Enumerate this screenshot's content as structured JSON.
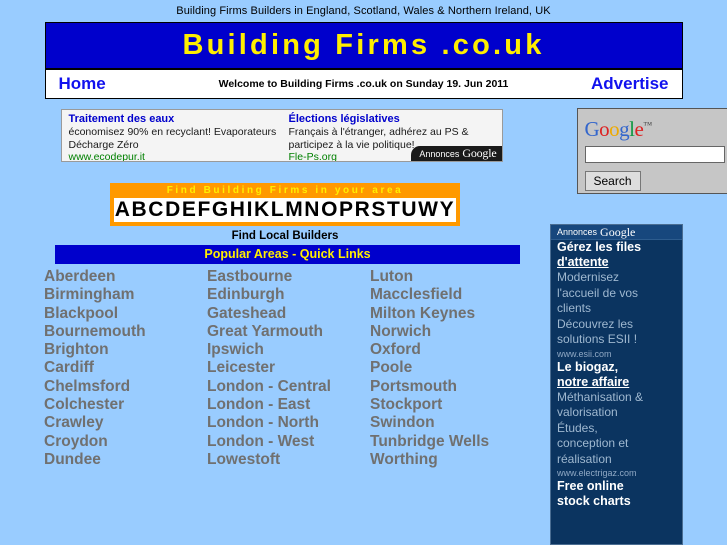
{
  "strapline": "Building Firms Builders in England, Scotland, Wales & Northern Ireland, UK",
  "header": {
    "banner_title": "Building Firms .co.uk",
    "nav_home": "Home",
    "welcome": "Welcome to Building Firms .co.uk on Sunday 19. Jun 2011",
    "nav_advertise": "Advertise"
  },
  "top_ads": {
    "annonces_label": "Annonces",
    "annonces_google": "Google",
    "units": [
      {
        "title": "Traitement des eaux",
        "line1": "économisez 90% en recyclant! Evaporateurs",
        "line2": "Décharge Zéro",
        "url": "www.ecodepur.it"
      },
      {
        "title": "Élections législatives",
        "line1": "Français à l'étranger, adhérez au PS &",
        "line2": "participez à la vie politique!",
        "url": "Fle-Ps.org"
      }
    ]
  },
  "google_search": {
    "logo_letters": [
      "G",
      "o",
      "o",
      "g",
      "l",
      "e"
    ],
    "trademark": "™",
    "query_value": "",
    "placeholder": "",
    "button_label": "Search"
  },
  "find_firms": {
    "banner": "Find Building Firms in your area",
    "alphabet": "ABCDEFGHIKLMNOPRSTUWY",
    "subtitle": "Find Local Builders"
  },
  "popular_areas": {
    "header": "Popular Areas - Quick Links",
    "columns": [
      [
        "Aberdeen",
        "Birmingham",
        "Blackpool",
        "Bournemouth",
        "Brighton",
        "Cardiff",
        "Chelmsford",
        "Colchester",
        "Crawley",
        "Croydon",
        "Dundee"
      ],
      [
        "Eastbourne",
        "Edinburgh",
        "Gateshead",
        "Great Yarmouth",
        "Ipswich",
        "Leicester",
        "London - Central",
        "London - East",
        "London - North",
        "London - West",
        "Lowestoft"
      ],
      [
        "Luton",
        "Macclesfield",
        "Milton Keynes",
        "Norwich",
        "Oxford",
        "Poole",
        "Portsmouth",
        "Stockport",
        "Swindon",
        "Tunbridge Wells",
        "Worthing"
      ]
    ]
  },
  "sidebar_ads": {
    "annonces_label": "Annonces",
    "annonces_google": "Google",
    "items": [
      {
        "title1": "Gérez les files",
        "title2": "d'attente",
        "lines": [
          "Modernisez",
          "l'accueil de vos",
          "clients",
          "Découvrez les",
          "solutions ESII !"
        ],
        "url": "www.esii.com"
      },
      {
        "title1": "Le biogaz,",
        "title2": "notre affaire",
        "lines": [
          "Méthanisation &",
          "valorisation",
          "Études,",
          "conception et",
          "réalisation"
        ],
        "url": "www.electrigaz.com"
      },
      {
        "title1": "Free online",
        "title2": "stock charts",
        "lines": [],
        "url": ""
      }
    ]
  },
  "colors": {
    "page_background": "#99ccff",
    "banner_blue": "#0000cc",
    "banner_yellow": "#ffee00",
    "orange": "#ff9900",
    "link_grey": "#707070",
    "nav_link_blue": "#1111ee",
    "sidebar_navy": "#0b3460"
  }
}
